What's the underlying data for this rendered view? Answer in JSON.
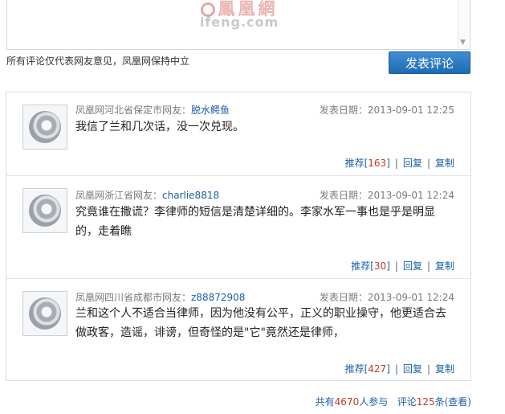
{
  "editor": {
    "watermark_logo": "鳳凰網",
    "watermark_site": "ifeng.com"
  },
  "notice": "所有评论仅代表网友意见，凤凰网保持中立",
  "post_button": "发表评论",
  "comments": [
    {
      "location": "凤凰网河北省保定市网友：",
      "user": "脱水鳄鱼",
      "date": "发表日期：2013-09-01 12:25",
      "body": "我信了兰和几次话，没一次兑现。",
      "recommend_label": "推荐",
      "recommend_count": "163",
      "reply": "回复",
      "copy": "复制"
    },
    {
      "location": "凤凰网浙江省网友：",
      "user": "charlie8818",
      "date": "发表日期：2013-09-01 12:24",
      "body": "究竟谁在撒谎？李律师的短信是清楚详细的。李家水军一事也是乎是明显的，走着瞧",
      "recommend_label": "推荐",
      "recommend_count": "30",
      "reply": "回复",
      "copy": "复制"
    },
    {
      "location": "凤凰网四川省成都市网友：",
      "user": "z88872908",
      "date": "发表日期：2013-09-01 12:24",
      "body": "兰和这个人不适合当律师，因为他没有公平，正义的职业操守，他更适合去做政客，造谣，诽谤，但奇怪的是\"它\"竟然还是律师，",
      "recommend_label": "推荐",
      "recommend_count": "427",
      "reply": "回复",
      "copy": "复制"
    }
  ],
  "summary": {
    "prefix": "共有",
    "participants": "4670",
    "participants_suffix": "人参与",
    "comments_prefix": "评论",
    "comments": "125",
    "comments_suffix": "条",
    "view": "(查看)"
  }
}
